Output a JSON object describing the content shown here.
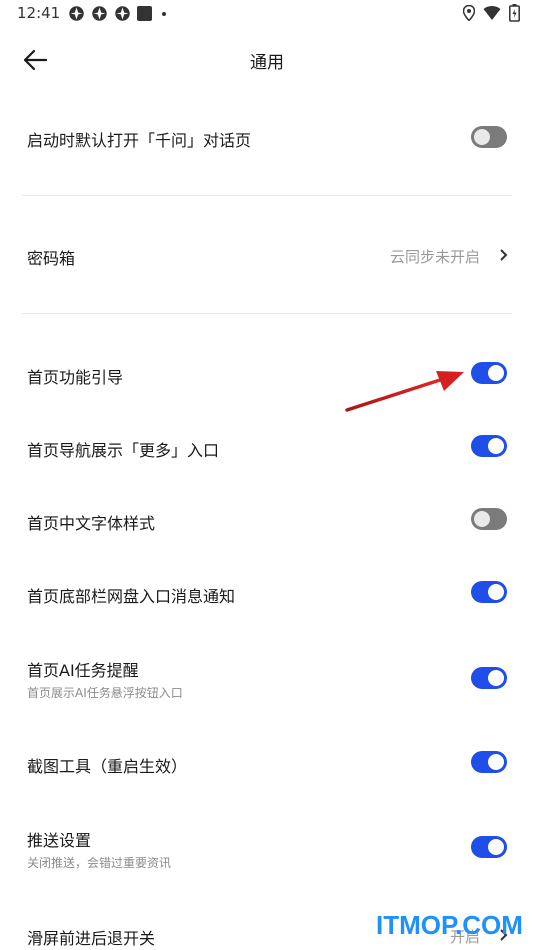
{
  "status_bar": {
    "time": "12:41"
  },
  "header": {
    "title": "通用"
  },
  "settings": [
    {
      "label": "启动时默认打开「千问」对话页",
      "toggle": "off"
    },
    {
      "label": "密码箱",
      "value": "云同步未开启"
    },
    {
      "label": "首页功能引导",
      "toggle": "on"
    },
    {
      "label": "首页导航展示「更多」入口",
      "toggle": "on"
    },
    {
      "label": "首页中文字体样式",
      "toggle": "off"
    },
    {
      "label": "首页底部栏网盘入口消息通知",
      "toggle": "on"
    },
    {
      "label": "首页AI任务提醒",
      "sub": "首页展示AI任务悬浮按钮入口",
      "toggle": "on"
    },
    {
      "label": "截图工具（重启生效）",
      "toggle": "on"
    },
    {
      "label": "推送设置",
      "sub": "关闭推送，会错过重要资讯",
      "toggle": "on"
    },
    {
      "label": "滑屏前进后退开关",
      "value": "开启"
    }
  ],
  "watermark": "ITMOP.COM",
  "colors": {
    "accent": "#1f4ee8",
    "toggle_off": "#7b7b7b",
    "annotation_arrow": "#d42020",
    "watermark": "#1e90ff"
  }
}
